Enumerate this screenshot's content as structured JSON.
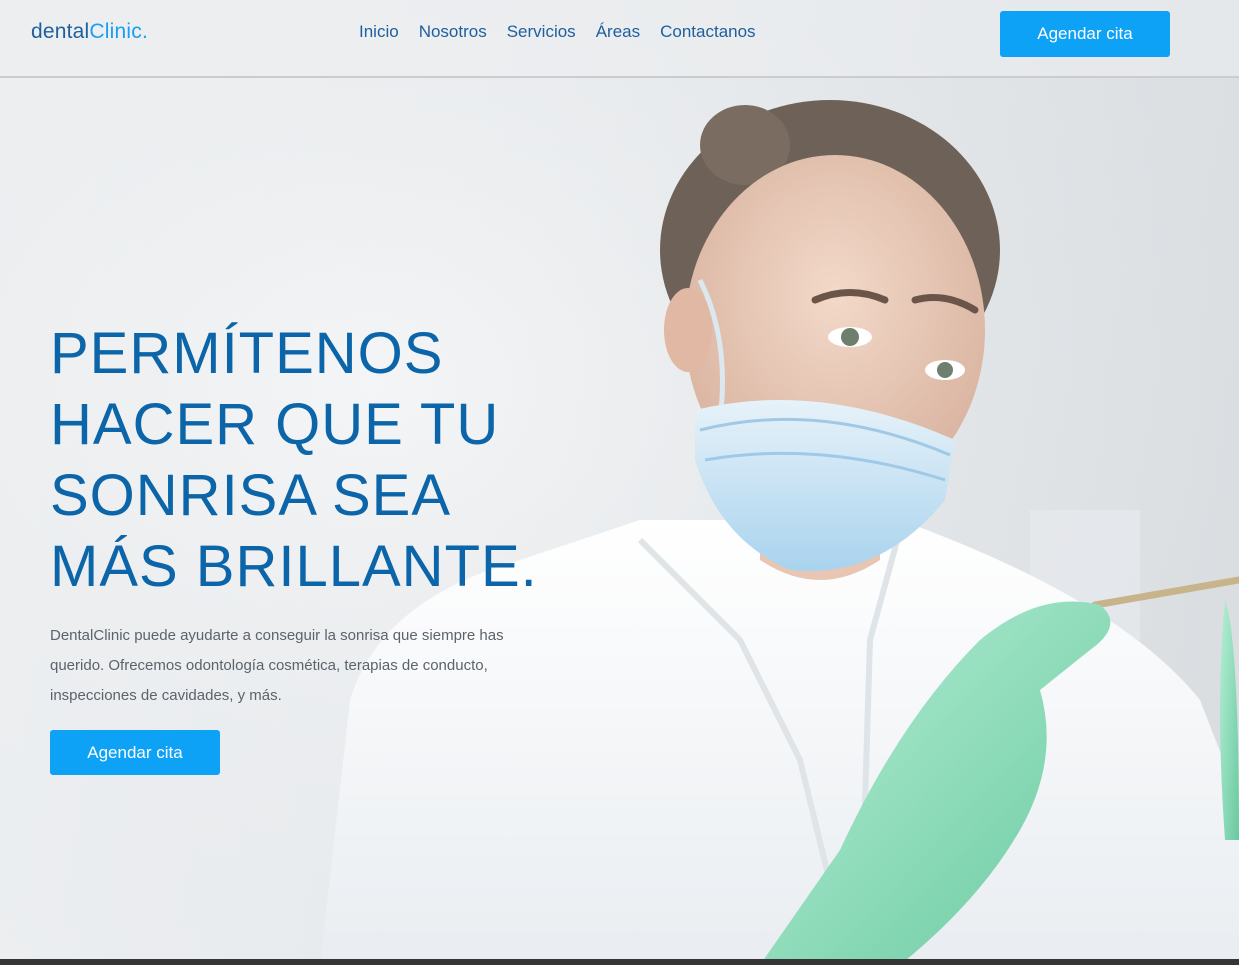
{
  "header": {
    "logo": {
      "part1": "dental",
      "part2": "Clinic."
    },
    "nav": [
      "Inicio",
      "Nosotros",
      "Servicios",
      "Áreas",
      "Contactanos"
    ],
    "cta_label": "Agendar cita"
  },
  "hero": {
    "headline": [
      "PERMÍTENOS",
      "HACER QUE TU",
      "SONRISA SEA",
      "MÁS BRILLANTE."
    ],
    "lead": "DentalClinic puede ayudarte a conseguir la sonrisa que siempre has querido. Ofrecemos odontología cosmética, terapias de conducto, inspecciones de cavidades, y más.",
    "cta_label": "Agendar cita",
    "image_subject": "dentist-woman-with-mask"
  },
  "colors": {
    "brand_dark": "#1e5f9e",
    "brand_light": "#1a9ef5",
    "headline": "#0b65a8",
    "button": "#0da2f5"
  }
}
